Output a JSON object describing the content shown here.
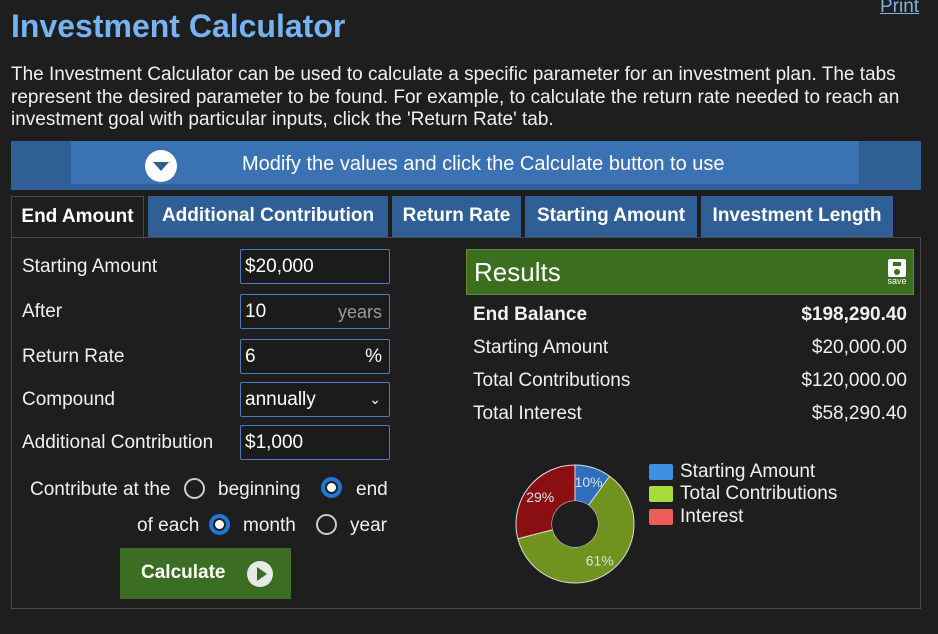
{
  "header": {
    "print_label": "Print",
    "title": "Investment Calculator",
    "intro": "The Investment Calculator can be used to calculate a specific parameter for an investment plan. The tabs represent the desired parameter to be found. For example, to calculate the return rate needed to reach an investment goal with particular inputs, click the 'Return Rate' tab."
  },
  "banner": {
    "text": "Modify the values and click the Calculate button to use",
    "icon": "chevron-down-icon"
  },
  "tabs": [
    {
      "label": "End Amount",
      "active": true
    },
    {
      "label": "Additional Contribution",
      "active": false
    },
    {
      "label": "Return Rate",
      "active": false
    },
    {
      "label": "Starting Amount",
      "active": false
    },
    {
      "label": "Investment Length",
      "active": false
    }
  ],
  "form": {
    "starting_amount": {
      "label": "Starting Amount",
      "value": "$20,000"
    },
    "after": {
      "label": "After",
      "value": "10",
      "unit": "years"
    },
    "return_rate": {
      "label": "Return Rate",
      "value": "6",
      "unit": "%"
    },
    "compound": {
      "label": "Compound",
      "value": "annually"
    },
    "additional_contribution": {
      "label": "Additional Contribution",
      "value": "$1,000"
    },
    "contribute_at": {
      "label": "Contribute at the",
      "options": [
        "beginning",
        "end"
      ],
      "selected": "end"
    },
    "of_each": {
      "label": "of each",
      "options": [
        "month",
        "year"
      ],
      "selected": "month"
    },
    "calculate_label": "Calculate"
  },
  "results": {
    "title": "Results",
    "save_label": "save",
    "rows": [
      {
        "label": "End Balance",
        "value": "$198,290.40"
      },
      {
        "label": "Starting Amount",
        "value": "$20,000.00"
      },
      {
        "label": "Total Contributions",
        "value": "$120,000.00"
      },
      {
        "label": "Total Interest",
        "value": "$58,290.40"
      }
    ]
  },
  "chart_data": {
    "type": "pie",
    "categories": [
      "Starting Amount",
      "Total Contributions",
      "Interest"
    ],
    "values": [
      10,
      61,
      29
    ],
    "labels": [
      "10%",
      "61%",
      "29%"
    ],
    "colors": [
      "#2f6dbf",
      "#6f931e",
      "#8a0f13"
    ],
    "legend_colors": [
      "#3d8fe0",
      "#a8dc3c",
      "#ef5b5b"
    ],
    "legend": "right"
  },
  "colors": {
    "accent": "#2f5f94",
    "title": "#75b3f2",
    "results": "#3c6e1f"
  }
}
